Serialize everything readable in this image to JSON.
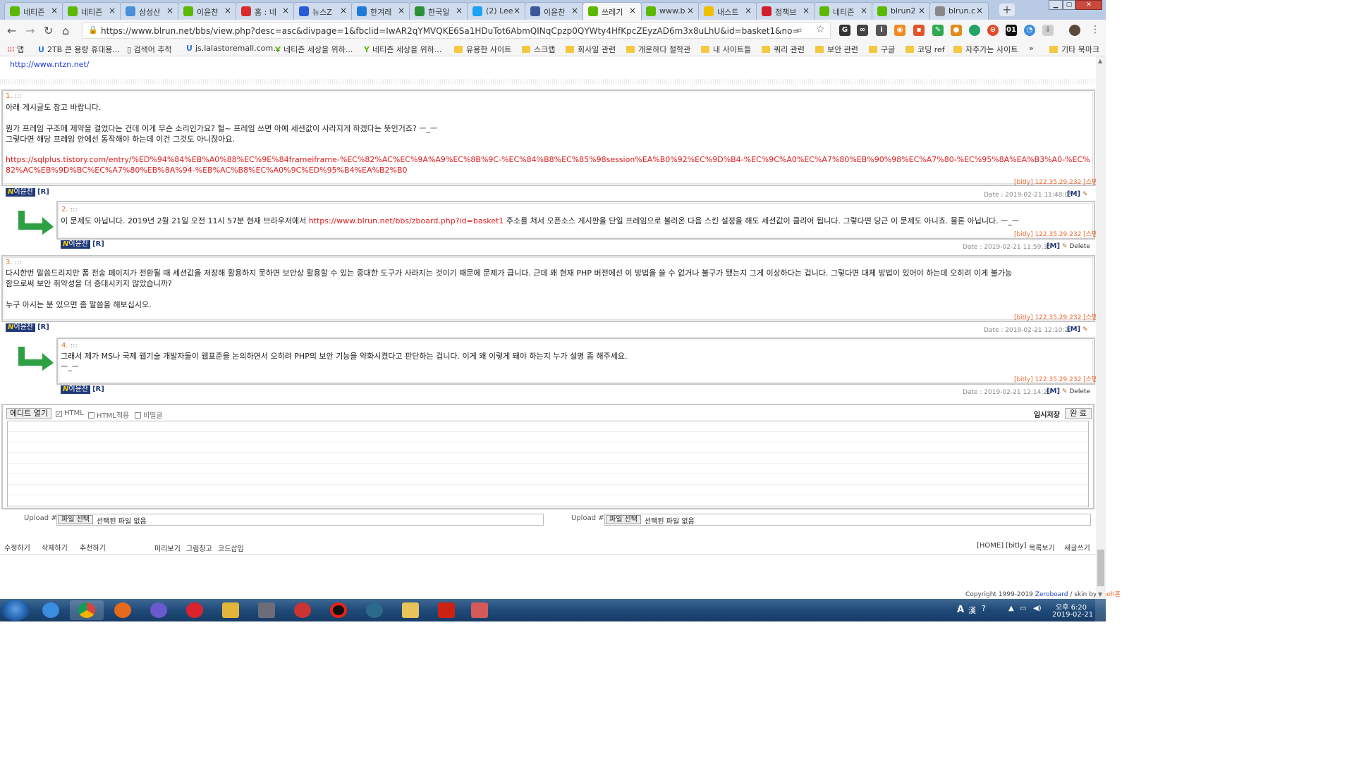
{
  "browser": {
    "tabs": [
      {
        "title": "네티즌",
        "favicon": "leaf-icon",
        "color": "#5cb800"
      },
      {
        "title": "네티즌",
        "favicon": "leaf-icon",
        "color": "#5cb800"
      },
      {
        "title": "삼성산",
        "favicon": "globe-icon",
        "color": "#4a90d9"
      },
      {
        "title": "이윤찬",
        "favicon": "leaf-icon",
        "color": "#5cb800"
      },
      {
        "title": "홈 : 네",
        "favicon": "red-hex-icon",
        "color": "#d92b2b"
      },
      {
        "title": "뉴스Z",
        "favicon": "z-icon",
        "color": "#2a5bd7"
      },
      {
        "title": "한겨레",
        "favicon": "hani-icon",
        "color": "#1f7ad9"
      },
      {
        "title": "한국일",
        "favicon": "person-icon",
        "color": "#2f8f3a"
      },
      {
        "title": "(2) Lee",
        "favicon": "twitter-icon",
        "color": "#1da1f2"
      },
      {
        "title": "이윤찬",
        "favicon": "facebook-icon",
        "color": "#3b5998"
      },
      {
        "title": "쓰레기",
        "favicon": "leaf-icon",
        "color": "#5cb800",
        "active": true
      },
      {
        "title": "www.b",
        "favicon": "leaf-icon",
        "color": "#5cb800"
      },
      {
        "title": "내스트",
        "favicon": "note-icon",
        "color": "#f0c000"
      },
      {
        "title": "정책브",
        "favicon": "flag-icon",
        "color": "#d21e2b"
      },
      {
        "title": "네티즌",
        "favicon": "leaf-icon",
        "color": "#5cb800"
      },
      {
        "title": "blrun2",
        "favicon": "leaf-icon",
        "color": "#5cb800"
      },
      {
        "title": "blrun.c",
        "favicon": "page-icon",
        "color": "#888888"
      }
    ],
    "url": "https://www.blrun.net/bbs/view.php?desc=asc&divpage=1&fbclid=IwAR2qYMVQKE6Sa1HDuTot6AbmQINqCpzp0QYWty4HfKpcZEyzAD6m3x8uLhU&id=basket1&no=323&page=1&sc=on...",
    "bookmarks": [
      {
        "label": "앱",
        "type": "apps"
      },
      {
        "label": "2TB 큰 용량 휴대용...",
        "type": "u"
      },
      {
        "label": "검색어 추적",
        "type": "page"
      },
      {
        "label": "js.lalastoremall.com...",
        "type": "u"
      },
      {
        "label": "네티즌 세상을 위하...",
        "type": "leaf"
      },
      {
        "label": "네티즌 세상을 위하...",
        "type": "leaf"
      },
      {
        "label": "유용한 사이트",
        "type": "folder"
      },
      {
        "label": "스크랩",
        "type": "folder"
      },
      {
        "label": "회사일 관련",
        "type": "folder"
      },
      {
        "label": "개운하다 절학관",
        "type": "folder"
      },
      {
        "label": "내 사이트들",
        "type": "folder"
      },
      {
        "label": "쿼리 관련",
        "type": "folder"
      },
      {
        "label": "보안 관련",
        "type": "folder"
      },
      {
        "label": "구글",
        "type": "folder"
      },
      {
        "label": "코딩 ref",
        "type": "folder"
      },
      {
        "label": "자주가는 사이트",
        "type": "folder"
      },
      {
        "label": "»",
        "type": "more"
      },
      {
        "label": "기타 북마크",
        "type": "folder"
      }
    ]
  },
  "page": {
    "top_link": "http://www.ntzn.net/",
    "comments": [
      {
        "num": "1.",
        "sep": ":::",
        "lines": [
          "아래 게시글도 참고 바랍니다.",
          "",
          "뭔가 프레임 구조에 제약을 걸었다는 건데 이게 무슨 소리인가요? 헐~ 프레임 쓰면 아예 세션값이 사라지게 하겠다는 뜻인거죠? ㅡ_ㅡ",
          "그렇다면 해당 프레임 안에선 동작해야 하는데 이건 그것도 아니잖아요."
        ],
        "link": "https://sqlplus.tistory.com/entry/%ED%94%84%EB%A0%88%EC%9E%84frameiframe-%EC%82%AC%EC%9A%A9%EC%8B%9C-%EC%84%B8%EC%85%98session%EA%B0%92%EC%9D%B4-%EC%9C%A0%EC%A7%80%EB%90%98%EC%A7%80-%EC%95%8A%EA%B3%A0-%EC%82%AC%EB%9D%BC%EC%A7%80%EB%8A%94-%EB%AC%B8%EC%A0%9C%ED%95%B4%EA%B2%B0",
        "ip": "[bitly] 122.35.29.232 [스팸]",
        "author": "이윤찬",
        "r": "[R]",
        "date_label": "Date :",
        "date": "2019-02-21 11:48:05",
        "m": "[M]",
        "delete": ""
      },
      {
        "num": "2.",
        "sep": ":::",
        "text_before": "이 문제도 아닙니다. 2019년 2월 21일 오전 11시 57분 현재 브라우저에서 ",
        "inline_link": "https://www.blrun.net/bbs/zboard.php?id=basket1",
        "text_after": " 주소를 쳐서 오픈소스 게시판을 단일 프레임으로 불러온 다음 스킨 설정을 해도 세션값이 클리어 됩니다. 그렇다면 당근 이 문제도 아니죠. 물론 아닙니다. ㅡ_ㅡ",
        "ip": "[bitly] 122.35.29.232 [스팸]",
        "author": "이윤찬",
        "r": "[R]",
        "date_label": "Date :",
        "date": "2019-02-21 11:59:35",
        "m": "[M]",
        "delete": "Delete"
      },
      {
        "num": "3.",
        "sep": ":::",
        "lines": [
          "다시한번 말씀드리지만 폼 전송 페이지가 전환될 때 세션값을 저장해 활용하지 못하면 보안상 활용할 수 있는 중대한 도구가 사라지는 것이기 때문에 문제가 큽니다. 근데 왜 현재 PHP 버전에선 이 방법을 쓸 수 없거나 불구가 됐는지 그게 이상하다는 겁니다. 그렇다면 대체 방법이 있어야 하는데 오히려 이게 불가능",
          "함으로써 보안 취약성을 더 증대시키지 않았습니까?",
          "",
          "누구 아시는 분 있으면 좀 말씀을 해보십시오."
        ],
        "ip": "[bitly] 122.35.29.232 [스팸]",
        "author": "이윤찬",
        "r": "[R]",
        "date_label": "Date :",
        "date": "2019-02-21 12:10:20",
        "m": "[M]",
        "delete": ""
      },
      {
        "num": "4.",
        "sep": ":::",
        "lines": [
          "그래서 제가 MS나 국제 웹기술 개발자들이 웹표준을 논의하면서 오히려 PHP의 보안 기능을 약화시켰다고 판단하는 겁니다. 이게 왜 이렇게 돼야 하는지 누가 설명 좀 해주세요.",
          "ㅡ_ㅡ"
        ],
        "ip": "[bitly] 122.35.29.232 [스팸]",
        "author": "이윤찬",
        "r": "[R]",
        "date_label": "Date :",
        "date": "2019-02-21 12:14:29",
        "m": "[M]",
        "delete": "Delete"
      }
    ],
    "editor": {
      "open_button": "에디트 열기",
      "html_check": "HTML",
      "html_apply": "HTML적용",
      "secret": "비밀글",
      "temp_save": "임시저장",
      "done_button": "완 료"
    },
    "uploads": [
      {
        "label": "Upload #1",
        "button": "파일 선택",
        "status": "선택된 파일 없음"
      },
      {
        "label": "Upload #2",
        "button": "파일 선택",
        "status": "선택된 파일 없음"
      }
    ],
    "bottom_left": [
      "수정하기",
      "삭제하기",
      "추천하기"
    ],
    "bottom_mid": [
      "미리보기",
      "그림창고",
      "코드삽입"
    ],
    "bottom_right": [
      "[HOME]",
      "[bitly]",
      "목록보기",
      "새글쓰기"
    ],
    "copyright_prefix": "Copyright 1999-2019",
    "copyright_zb": "Zeroboard",
    "copyright_skin": "/ skin by",
    "copyright_pooh": "pooh혼"
  },
  "taskbar": {
    "ime_label": "A",
    "ime_han": "漢",
    "time": "오후 6:20",
    "date": "2019-02-21"
  },
  "colors": {
    "accent_red": "#e31b1b",
    "ip_orange": "#e86a2f",
    "author_navy": "#223a7a",
    "arrow_green": "#2ea043"
  }
}
